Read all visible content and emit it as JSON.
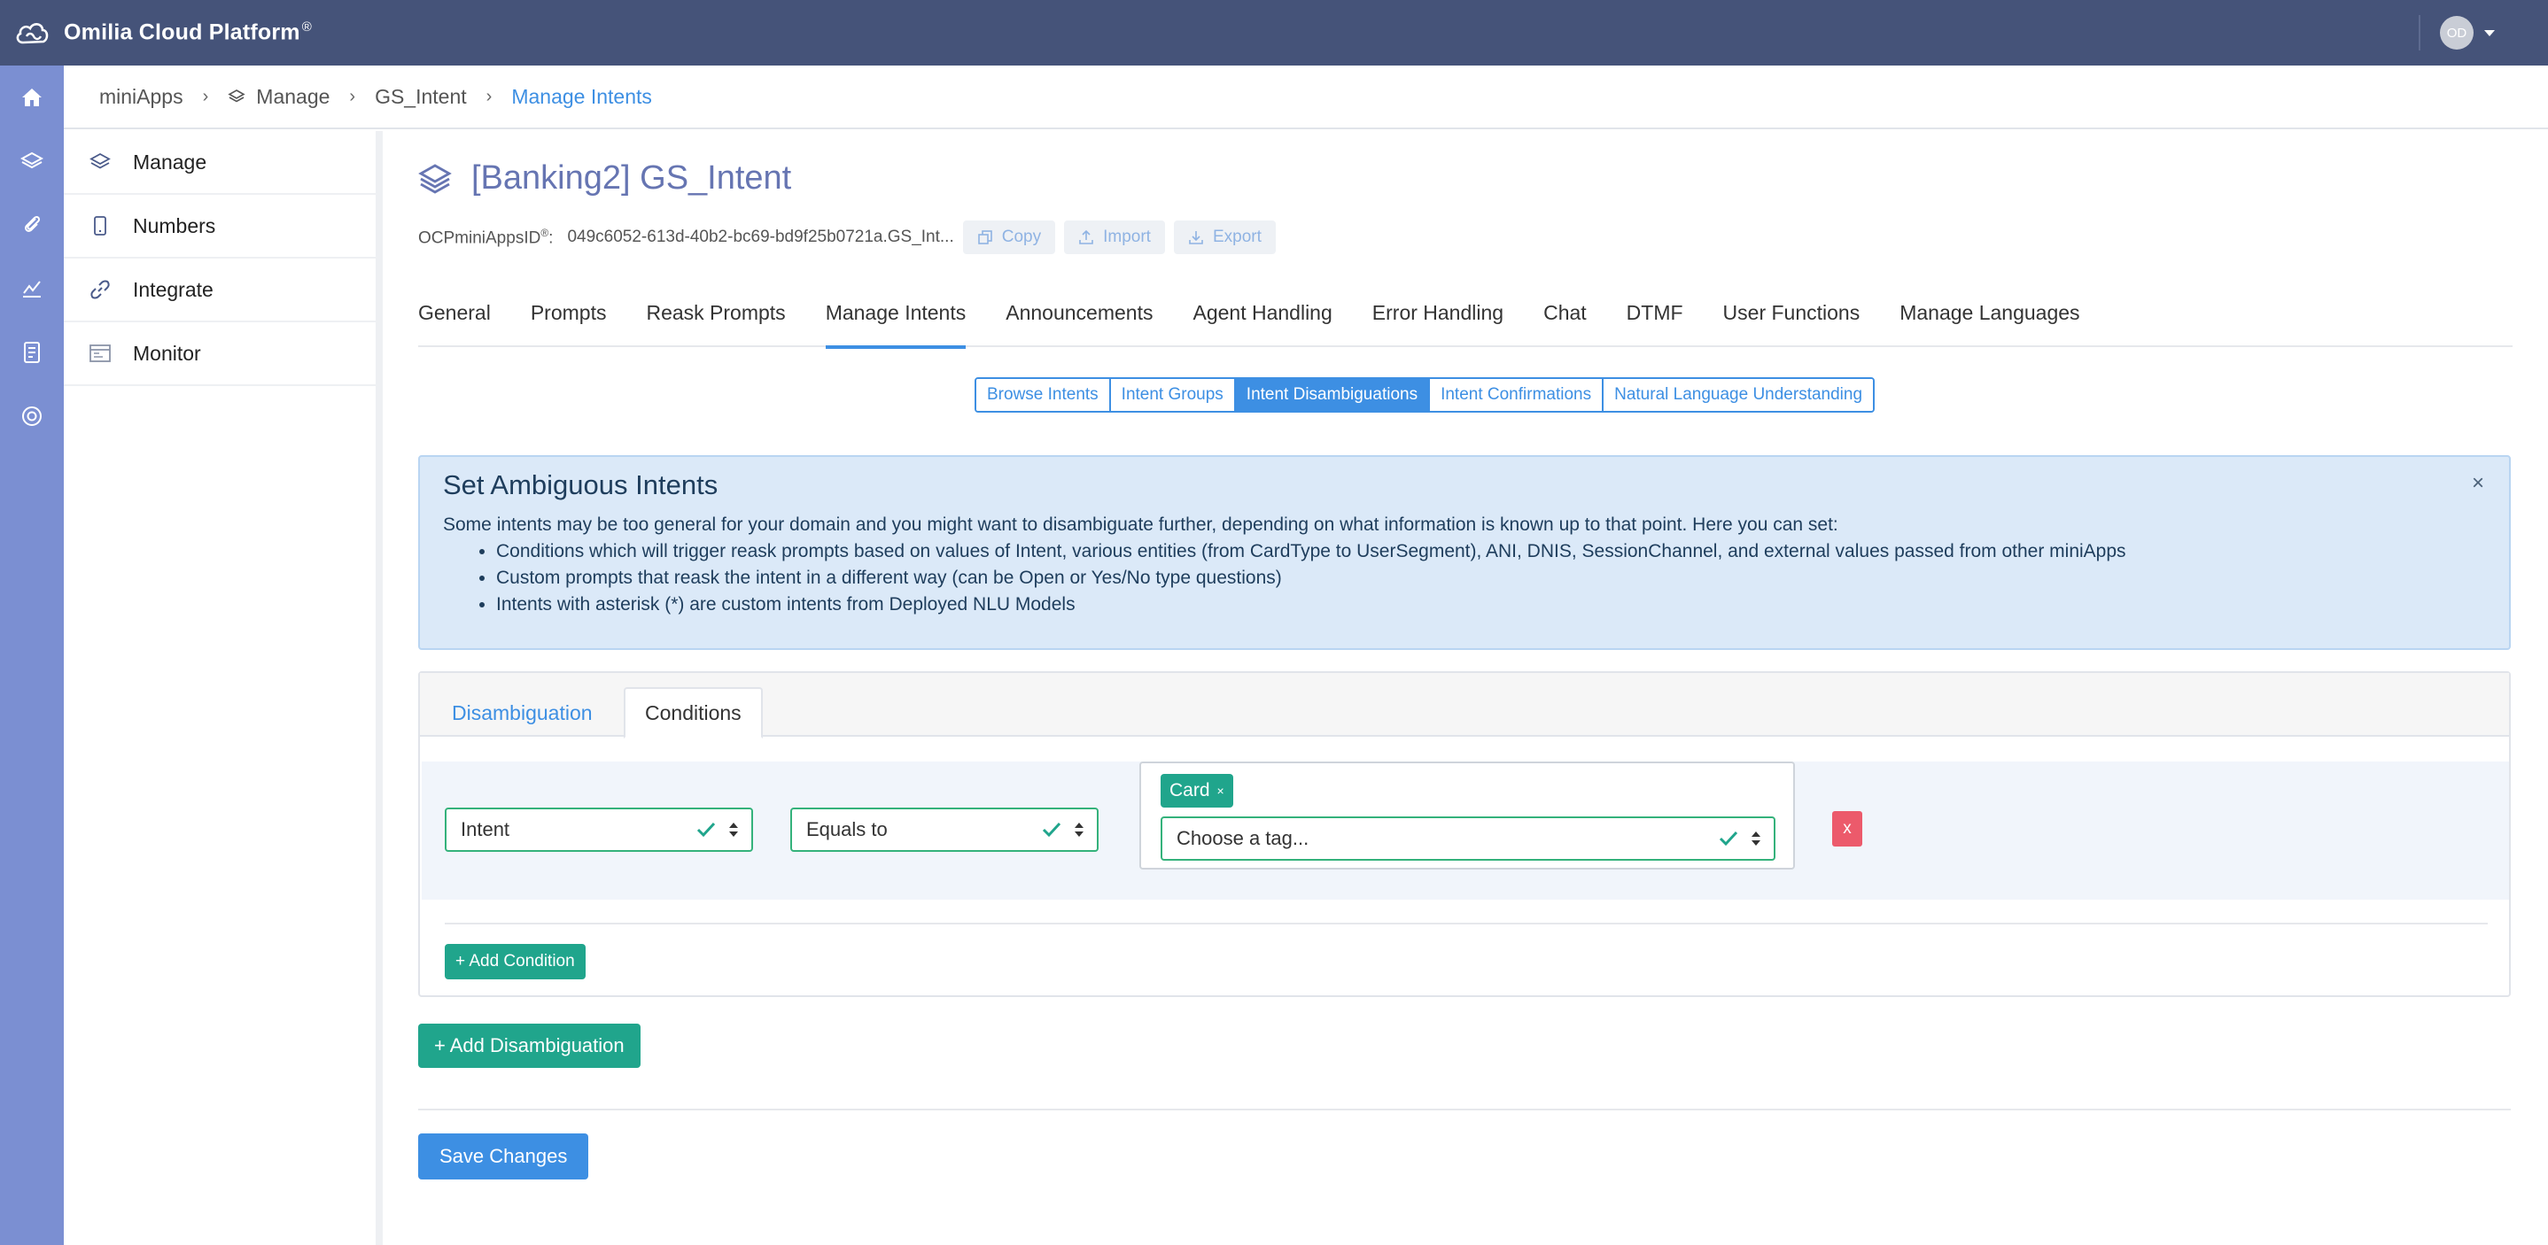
{
  "app": {
    "brand": "Omilia Cloud Platform",
    "brand_mark": "®",
    "user_initials": "OD"
  },
  "breadcrumb": [
    {
      "label": "miniApps"
    },
    {
      "label": "Manage"
    },
    {
      "label": "GS_Intent"
    },
    {
      "label": "Manage Intents"
    }
  ],
  "sidebar": {
    "items": [
      {
        "label": "Manage",
        "icon": "layers-icon"
      },
      {
        "label": "Numbers",
        "icon": "phone-icon"
      },
      {
        "label": "Integrate",
        "icon": "link-icon"
      },
      {
        "label": "Monitor",
        "icon": "monitor-icon"
      }
    ]
  },
  "rail": {
    "icons": [
      "home-icon",
      "layers-icon",
      "attachment-icon",
      "analytics-icon",
      "billing-icon",
      "support-icon"
    ]
  },
  "page": {
    "title": "[Banking2] GS_Intent",
    "id_label": "OCPminiAppsID",
    "id_mark": "®",
    "id_sep": ":",
    "id_value": "049c6052-613d-40b2-bc69-bd9f25b0721a.GS_Int...",
    "copy_label": "Copy",
    "import_label": "Import",
    "export_label": "Export"
  },
  "tabs": [
    {
      "label": "General"
    },
    {
      "label": "Prompts"
    },
    {
      "label": "Reask Prompts"
    },
    {
      "label": "Manage Intents",
      "active": true
    },
    {
      "label": "Announcements"
    },
    {
      "label": "Agent Handling"
    },
    {
      "label": "Error Handling"
    },
    {
      "label": "Chat"
    },
    {
      "label": "DTMF"
    },
    {
      "label": "User Functions"
    },
    {
      "label": "Manage Languages"
    }
  ],
  "subtabs": [
    {
      "label": "Browse Intents"
    },
    {
      "label": "Intent Groups"
    },
    {
      "label": "Intent Disambiguations",
      "active": true
    },
    {
      "label": "Intent Confirmations"
    },
    {
      "label": "Natural Language Understanding"
    }
  ],
  "info": {
    "title": "Set Ambiguous Intents",
    "intro": "Some intents may be too general for your domain and you might want to disambiguate further, depending on what information is known up to that point. Here you can set:",
    "bullets": [
      "Conditions which will trigger reask prompts based on values of Intent, various entities (from CardType to UserSegment), ANI, DNIS, SessionChannel, and external values passed from other miniApps",
      "Custom prompts that reask the intent in a different way (can be Open or Yes/No type questions)",
      "Intents with asterisk (*) are custom intents from Deployed NLU Models"
    ],
    "close_label": "×"
  },
  "panel": {
    "tab_disambiguation": "Disambiguation",
    "tab_conditions": "Conditions",
    "condition": {
      "field": "Intent",
      "operator": "Equals to",
      "tag": "Card",
      "tag_remove": "×",
      "tag_placeholder": "Choose a tag...",
      "delete_label": "x"
    },
    "add_condition_label": "+ Add Condition"
  },
  "actions": {
    "add_disambiguation_label": "+ Add Disambiguation",
    "save_label": "Save Changes"
  },
  "colors": {
    "topbar": "#455379",
    "rail": "#7b8fd2",
    "accent": "#3d8fe3",
    "green": "#20a58c",
    "danger": "#ec5a6b",
    "info_bg": "#dbe9f8"
  }
}
